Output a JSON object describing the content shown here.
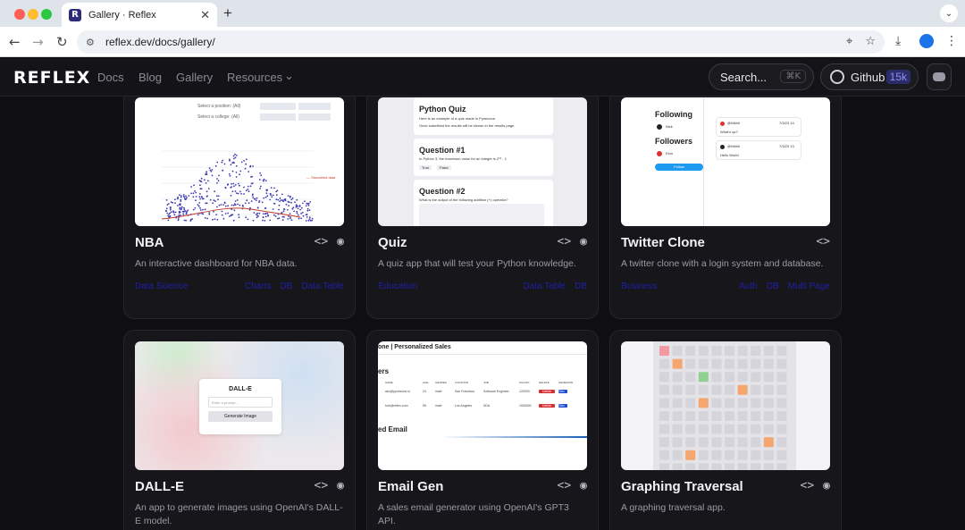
{
  "browser": {
    "tab_title": "Gallery · Reflex",
    "url": "reflex.dev/docs/gallery/",
    "new_tab": "+",
    "tab_close": "✕",
    "tab_menu": "⌄",
    "back": "←",
    "forward": "→",
    "reload": "↻",
    "site_info": "⚙",
    "translate": "⌖",
    "bookmark": "☆",
    "download": "⤓",
    "menu": "⋮",
    "traffic_colors": [
      "#ff5f57",
      "#febc2e",
      "#28c840"
    ]
  },
  "site": {
    "logo": "REFLEX",
    "nav": [
      "Docs",
      "Blog",
      "Gallery",
      "Resources"
    ],
    "resources_caret": "⌄",
    "search": "Search...",
    "search_kbd": "⌘K",
    "github": "Github",
    "github_count": "15k"
  },
  "cards": [
    {
      "title": "NBA",
      "desc": "An interactive dashboard for NBA data.",
      "tag_left": "Data Science",
      "tags_right": [
        "Charts",
        "DB",
        "Data Table"
      ]
    },
    {
      "title": "Quiz",
      "desc": "A quiz app that will test your Python knowledge.",
      "tag_left": "Education",
      "tags_right": [
        "Data Table",
        "DB"
      ]
    },
    {
      "title": "Twitter Clone",
      "desc": "A twitter clone with a login system and database.",
      "tag_left": "Business",
      "tags_right": [
        "Auth",
        "DB",
        "Multi Page"
      ]
    },
    {
      "title": "DALL-E",
      "desc": "An app to generate images using OpenAI's DALL-E model.",
      "tag_left": "",
      "tags_right": []
    },
    {
      "title": "Email Gen",
      "desc": "A sales email generator using OpenAI's GPT3 API.",
      "tag_left": "",
      "tags_right": []
    },
    {
      "title": "Graphing Traversal",
      "desc": "A graphing traversal app.",
      "tag_left": "",
      "tags_right": []
    }
  ],
  "actions": {
    "code": "<>",
    "view": "◉"
  },
  "thumbs": {
    "nba": {
      "select_position": "Select a position: (All)",
      "select_college": "Select a college: (All)",
      "legend": "— Smoothed data"
    },
    "quiz": {
      "title": "Python Quiz",
      "intro1": "Here is an example of a quiz made in Pynecone.",
      "intro2": "Once submitted the results will be shown in the results page.",
      "q1": "Question #1",
      "q1_text": "In Python 3, the maximum value for an integer is 2⁶³ - 1",
      "q1_opts": [
        "True",
        "False"
      ],
      "q2": "Question #2",
      "q2_text": "What is the output of the following addition (+) operator?"
    },
    "twitter": {
      "following": "Following",
      "followers": "Followers",
      "follow_name": "Nick",
      "follower_name": "Elon",
      "button": "Follow",
      "tweet1_user": "@Nikhil",
      "tweet1_time": "7/3/23 14",
      "tweet1": "What's up?",
      "tweet2_user": "@Nikhil",
      "tweet2_time": "7/3/23 13",
      "tweet2": "Hello World"
    },
    "dalle": {
      "title": "DALL-E",
      "placeholder": "Enter a prompt...",
      "button": "Generate Image"
    },
    "email": {
      "header": "one | Personalized Sales",
      "section": "ers",
      "cols": [
        "NAME",
        "AGE",
        "GENDER",
        "LOCATION",
        "JOB",
        "SALARY",
        "DELETE",
        "GENERATE"
      ],
      "rows": [
        [
          "abc@pynecone.io",
          "24",
          "male",
          "San Francisco",
          "Software Engineer",
          "120000",
          "Delete",
          "Gen"
        ],
        [
          "bob@reflex.com",
          "55",
          "male",
          "Los Angeles",
          "SDA",
          "1500000",
          "Delete",
          "Gen"
        ]
      ],
      "footer": "ed Email"
    }
  }
}
